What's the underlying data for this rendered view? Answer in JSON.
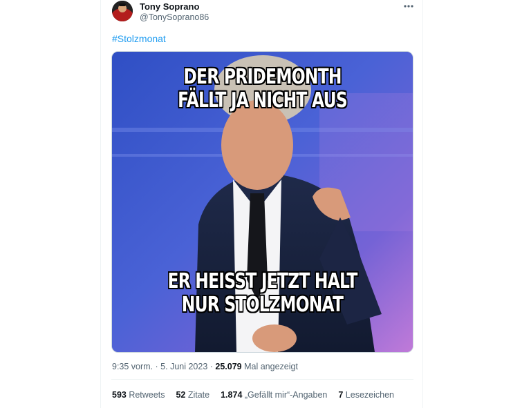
{
  "author": {
    "name": "Tony Soprano",
    "handle": "@TonySoprano86"
  },
  "tweet": {
    "hashtag": "#Stolzmonat"
  },
  "meme": {
    "top_line1": "DER PRIDEMONTH",
    "top_line2": "FÄLLT JA NICHT AUS",
    "bottom_line1": "ER HEISST JETZT HALT",
    "bottom_line2": "NUR STOLZMONAT"
  },
  "meta": {
    "time": "9:35 vorm.",
    "sep1": " · ",
    "date": "5. Juni 2023",
    "sep2": " · ",
    "views": "25.079",
    "views_label": " Mal angezeigt"
  },
  "stats": [
    {
      "count": "593",
      "label": " Retweets"
    },
    {
      "count": "52",
      "label": " Zitate"
    },
    {
      "count": "1.874",
      "label": " „Gefällt mir“-Angaben"
    },
    {
      "count": "7",
      "label": " Lesezeichen"
    }
  ],
  "colors": {
    "link": "#1d9bf0",
    "text": "#0f1419",
    "muted": "#536471",
    "border": "#eff3f4"
  },
  "icons": {
    "more": "more-horizontal-icon",
    "avatar": "avatar-image"
  }
}
